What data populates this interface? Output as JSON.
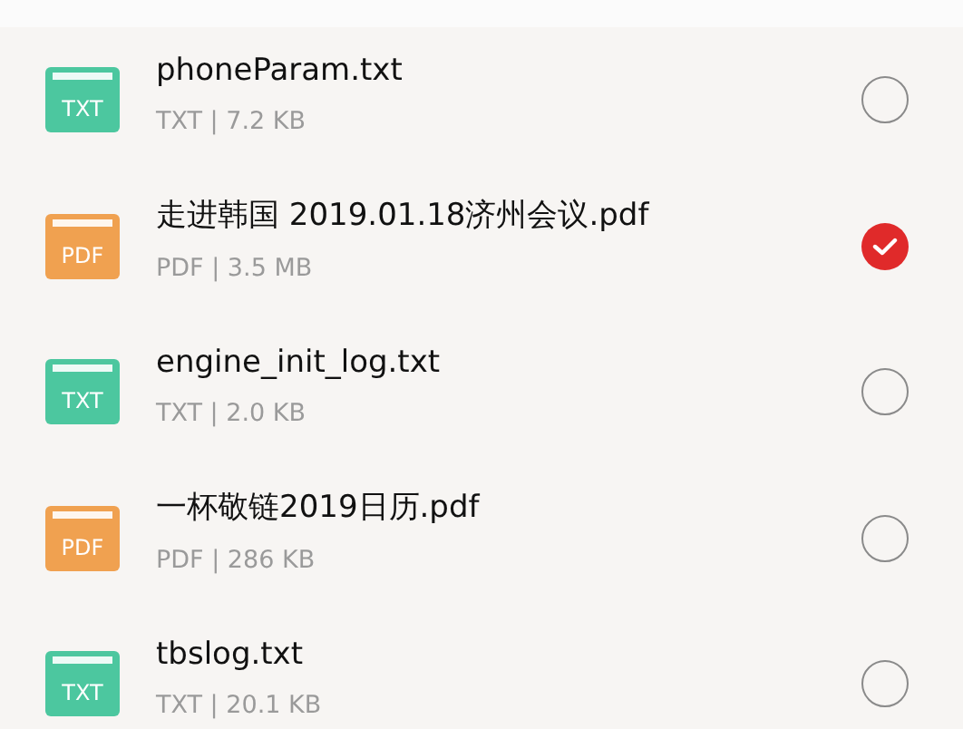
{
  "files": [
    {
      "kind": "txt",
      "icon_label": "TXT",
      "name": "phoneParam.txt",
      "meta": "TXT | 7.2 KB",
      "selected": false
    },
    {
      "kind": "pdf",
      "icon_label": "PDF",
      "name": "走进韩国 2019.01.18济州会议.pdf",
      "meta": "PDF | 3.5 MB",
      "selected": true
    },
    {
      "kind": "txt",
      "icon_label": "TXT",
      "name": "engine_init_log.txt",
      "meta": "TXT | 2.0 KB",
      "selected": false
    },
    {
      "kind": "pdf",
      "icon_label": "PDF",
      "name": "一杯敬链2019日历.pdf",
      "meta": "PDF | 286 KB",
      "selected": false
    },
    {
      "kind": "txt",
      "icon_label": "TXT",
      "name": "tbslog.txt",
      "meta": "TXT | 20.1 KB",
      "selected": false
    }
  ]
}
